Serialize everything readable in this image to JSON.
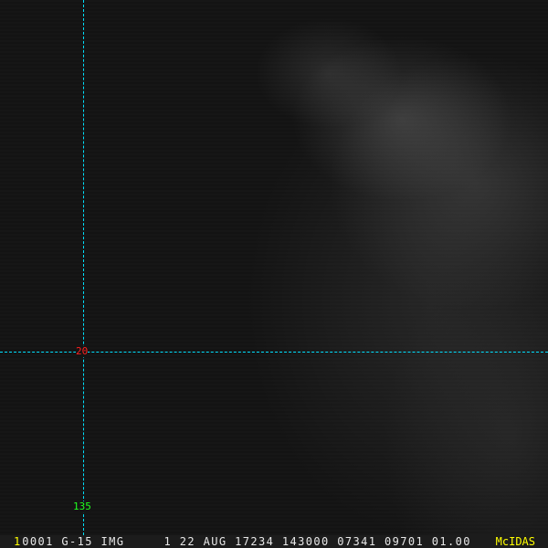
{
  "overlay": {
    "latitude_label": "20",
    "longitude_label": "135"
  },
  "status_bar": {
    "frame_number": "1",
    "info": "0001 G-15 IMG     1 22 AUG 17234 143000 07341 09701 01.00",
    "brand": "McIDAS"
  },
  "colors": {
    "gridline": "#00e0ff",
    "latitude_label": "#ff2020",
    "longitude_label": "#20ff20",
    "brand": "#ffff00"
  }
}
